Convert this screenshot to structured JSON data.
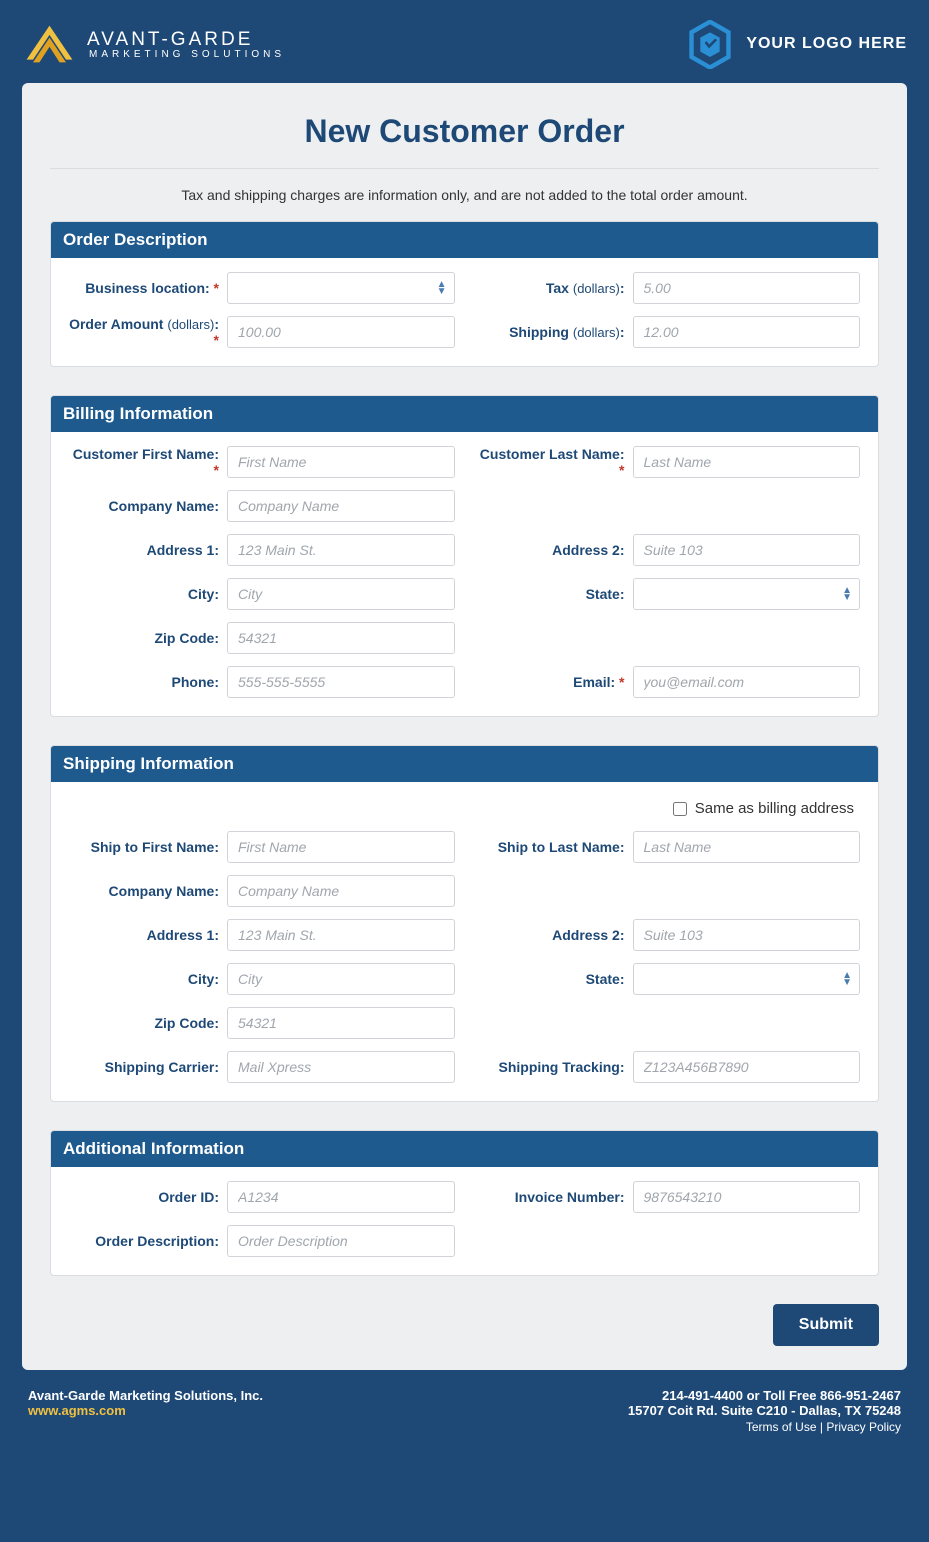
{
  "header": {
    "logo_line1": "AVANT-GARDE",
    "logo_line2": "MARKETING SOLUTIONS",
    "right_text": "YOUR LOGO HERE"
  },
  "page": {
    "title": "New Customer Order",
    "subtitle": "Tax and shipping charges are information only, and are not added to the total order amount."
  },
  "sections": {
    "order_desc": {
      "title": "Order Description",
      "business_location_label": "Business location:",
      "tax_label": "Tax",
      "tax_paren": "(dollars)",
      "tax_placeholder": "5.00",
      "order_amount_label": "Order Amount",
      "order_amount_paren": "(dollars)",
      "order_amount_placeholder": "100.00",
      "shipping_label": "Shipping",
      "shipping_paren": "(dollars)",
      "shipping_placeholder": "12.00"
    },
    "billing": {
      "title": "Billing Information",
      "first_name_label": "Customer First Name:",
      "first_name_placeholder": "First Name",
      "last_name_label": "Customer Last Name:",
      "last_name_placeholder": "Last Name",
      "company_label": "Company Name:",
      "company_placeholder": "Company Name",
      "addr1_label": "Address 1:",
      "addr1_placeholder": "123 Main St.",
      "addr2_label": "Address 2:",
      "addr2_placeholder": "Suite 103",
      "city_label": "City:",
      "city_placeholder": "City",
      "state_label": "State:",
      "zip_label": "Zip Code:",
      "zip_placeholder": "54321",
      "phone_label": "Phone:",
      "phone_placeholder": "555-555-5555",
      "email_label": "Email:",
      "email_placeholder": "you@email.com"
    },
    "shipping": {
      "title": "Shipping Information",
      "same_as_billing": "Same as billing address",
      "first_name_label": "Ship to First Name:",
      "first_name_placeholder": "First Name",
      "last_name_label": "Ship to Last Name:",
      "last_name_placeholder": "Last Name",
      "company_label": "Company Name:",
      "company_placeholder": "Company Name",
      "addr1_label": "Address 1:",
      "addr1_placeholder": "123 Main St.",
      "addr2_label": "Address 2:",
      "addr2_placeholder": "Suite 103",
      "city_label": "City:",
      "city_placeholder": "City",
      "state_label": "State:",
      "zip_label": "Zip Code:",
      "zip_placeholder": "54321",
      "carrier_label": "Shipping Carrier:",
      "carrier_placeholder": "Mail Xpress",
      "tracking_label": "Shipping Tracking:",
      "tracking_placeholder": "Z123A456B7890"
    },
    "additional": {
      "title": "Additional Information",
      "order_id_label": "Order ID:",
      "order_id_placeholder": "A1234",
      "invoice_label": "Invoice Number:",
      "invoice_placeholder": "9876543210",
      "desc_label": "Order Description:",
      "desc_placeholder": "Order Description"
    }
  },
  "submit_label": "Submit",
  "footer": {
    "company": "Avant-Garde Marketing Solutions, Inc.",
    "url": "www.agms.com",
    "phone": "214-491-4400 or Toll Free 866-951-2467",
    "address": "15707 Coit Rd. Suite C210 - Dallas, TX 75248",
    "terms": "Terms of Use",
    "privacy": "Privacy Policy",
    "sep": "  |  "
  }
}
